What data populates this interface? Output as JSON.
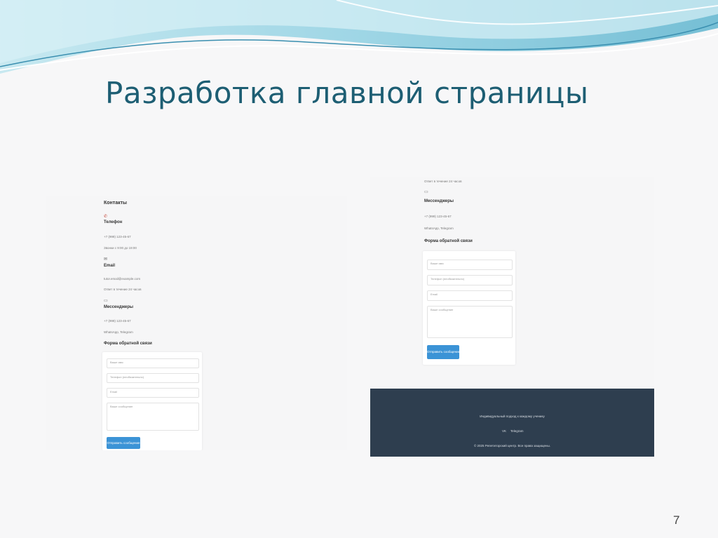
{
  "slide": {
    "title": "Разработка главной страницы",
    "page_number": "7"
  },
  "left_shot": {
    "contacts_heading": "Контакты",
    "phone_label": "Телефон",
    "phone_value": "+7 (999) 123-45-67",
    "phone_hours": "Звонки с 9:00 до 19:00",
    "email_label": "Email",
    "email_value": "tutor.email@example.com",
    "email_note": "Ответ в течение 24 часов",
    "messengers_label": "Мессенджеры",
    "messengers_phone": "+7 (999) 123-45-67",
    "messengers_list": "WhatsApp, Telegram",
    "form_heading": "Форма обратной связи",
    "form": {
      "name_placeholder": "Ваше имя",
      "phone_placeholder": "Телефон (необязательно)",
      "email_placeholder": "Email",
      "message_placeholder": "Ваше сообщение",
      "submit_label": "Отправить сообщение"
    }
  },
  "right_shot": {
    "email_note": "Ответ в течение 24 часов",
    "messengers_label": "Мессенджеры",
    "messengers_phone": "+7 (999) 123-45-67",
    "messengers_list": "WhatsApp, Telegram",
    "form_heading": "Форма обратной связи",
    "form": {
      "name_placeholder": "Ваше имя",
      "phone_placeholder": "Телефон (необязательно)",
      "email_placeholder": "Email",
      "message_placeholder": "Ваше сообщение",
      "submit_label": "Отправить сообщение"
    },
    "footer": {
      "tagline": "Индивидуальный подход к каждому ученику",
      "link_vk": "VK",
      "link_telegram": "Telegram",
      "copyright": "© 2025 Репетиторский центр. Все права защищены."
    }
  },
  "colors": {
    "title": "#1d5e73",
    "accent_button": "#3b93d6",
    "footer_bg": "#2e3e4f",
    "wave_light": "#a8dbe8",
    "wave_dark": "#5fb5cf"
  },
  "icons": [
    "phone-icon",
    "mail-icon",
    "chat-icon"
  ]
}
